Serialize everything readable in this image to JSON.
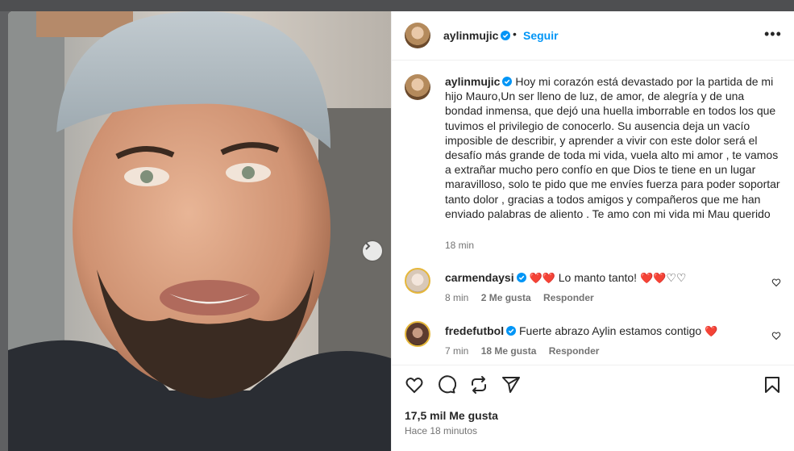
{
  "post": {
    "username": "aylinmujic",
    "follow_label": "Seguir",
    "more_label": "•••",
    "caption": "Hoy mi corazón está devastado por la partida de mi hijo Mauro,Un ser lleno de luz, de amor, de alegría y de una bondad inmensa, que dejó una huella imborrable en todos los que tuvimos el privilegio de conocerlo. Su ausencia deja un vacío imposible de describir, y aprender a vivir con este dolor será el desafío más grande de toda mi vida, vuela alto mi amor , te vamos a extrañar mucho pero confío en que Dios te tiene en un lugar maravilloso, solo te pido que me envíes fuerza para poder soportar tanto dolor , gracias a todos amigos y compañeros que me han enviado palabras de aliento . Te amo con mi vida mi Mau querido",
    "caption_time": "18 min",
    "likes": "17,5 mil Me gusta",
    "posted_ago": "Hace 18 minutos"
  },
  "comments": [
    {
      "username": "carmendaysi",
      "text": "Lo manto tanto!",
      "time": "8 min",
      "likes": "2 Me gusta",
      "reply": "Responder"
    },
    {
      "username": "fredefutbol",
      "text": "Fuerte abrazo Aylin estamos contigo",
      "time": "7 min",
      "likes": "18 Me gusta",
      "reply": "Responder"
    }
  ],
  "colors": {
    "accent": "#0095f6",
    "text": "#262626",
    "muted": "#737373",
    "heart": "#e0132b"
  },
  "icons": [
    "verified-icon",
    "next-arrow-icon",
    "like-icon",
    "comment-icon",
    "share-icon",
    "send-icon",
    "save-icon",
    "heart-outline-icon"
  ]
}
